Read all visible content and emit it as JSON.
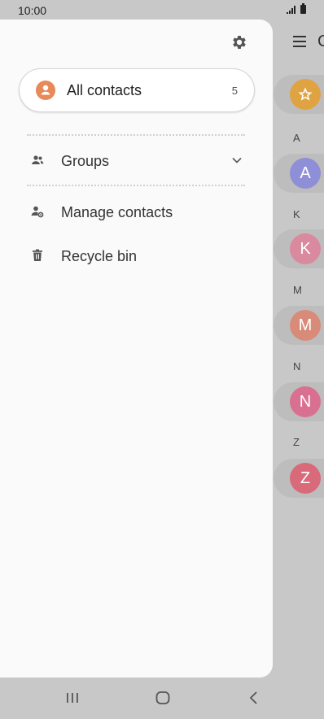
{
  "status_bar": {
    "time": "10:00"
  },
  "drawer": {
    "all_contacts": {
      "label": "All contacts",
      "count": "5"
    },
    "items": [
      {
        "label": "Groups"
      },
      {
        "label": "Manage contacts"
      },
      {
        "label": "Recycle bin"
      }
    ]
  },
  "background_list": {
    "header_partial": "C",
    "sections": [
      {
        "letter": "A",
        "initial": "A",
        "color": "#8f8fd8"
      },
      {
        "letter": "K",
        "initial": "K",
        "color": "#d98a9e"
      },
      {
        "letter": "M",
        "initial": "M",
        "color": "#d98b7a"
      },
      {
        "letter": "N",
        "initial": "N",
        "color": "#d97092"
      },
      {
        "letter": "Z",
        "initial": "Z",
        "color": "#d96a7a"
      }
    ],
    "favorites_color": "#e0a341"
  },
  "colors": {
    "accent": "#e8895a",
    "drawer_bg": "#fafafa",
    "scrim": "#c8c8c8"
  }
}
